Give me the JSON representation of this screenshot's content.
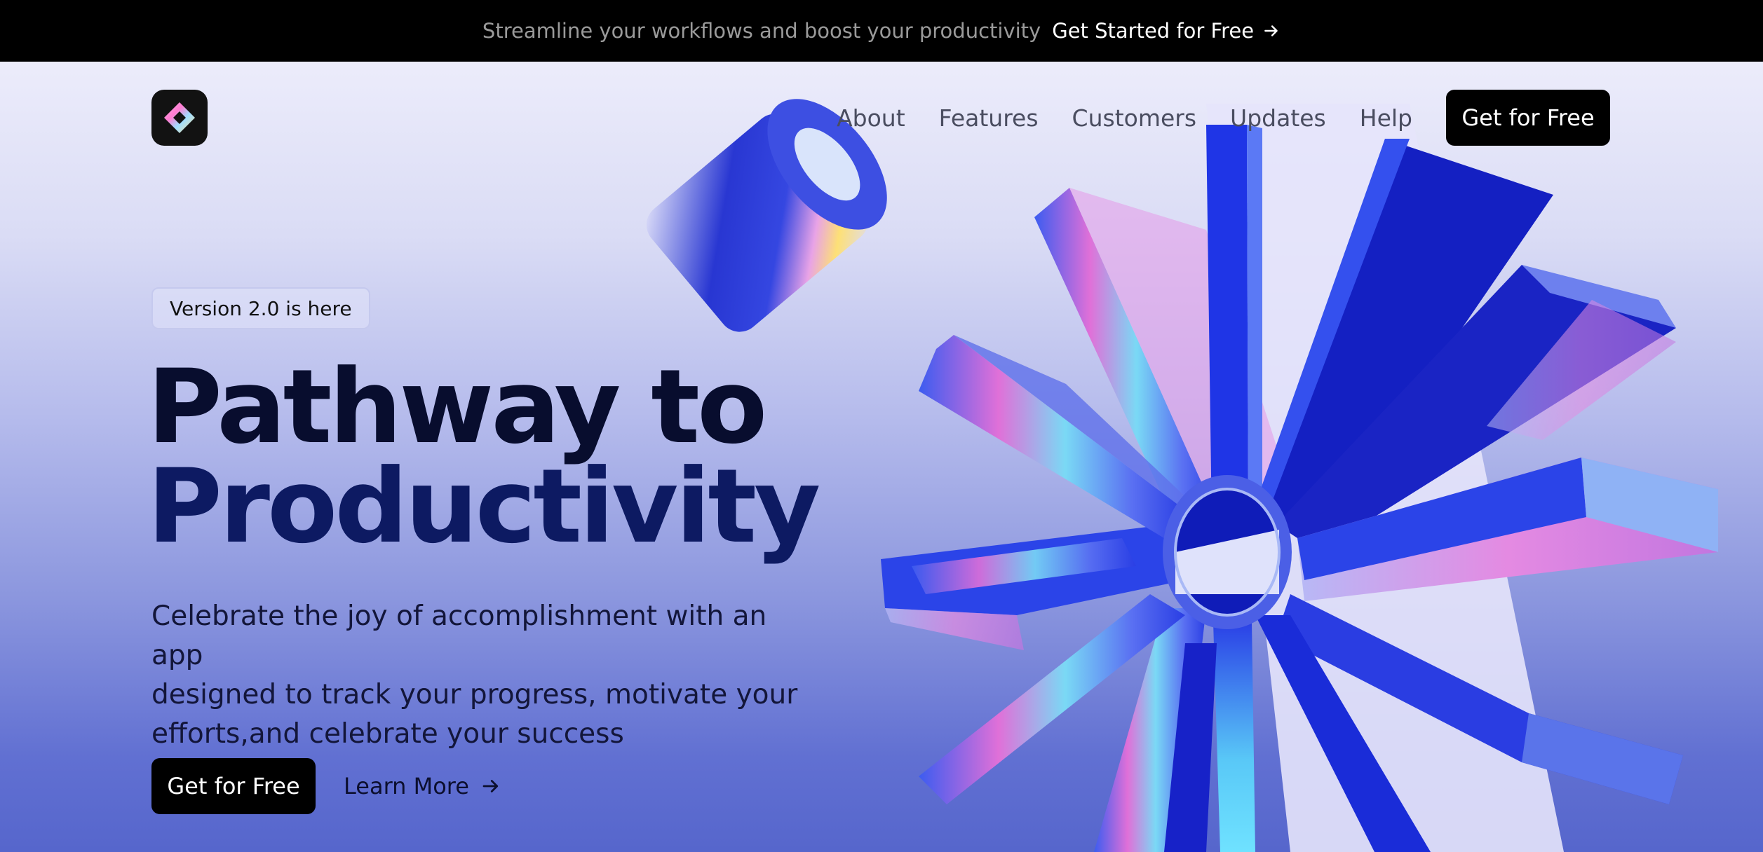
{
  "announcement": {
    "message": "Streamline your workflows and boost your productivity",
    "cta_label": "Get Started for Free",
    "cta_icon": "arrow-right-icon"
  },
  "nav": {
    "logo_icon": "diamond-logo-icon",
    "links": [
      "About",
      "Features",
      "Customers",
      "Updates",
      "Help"
    ],
    "cta_label": "Get for Free"
  },
  "hero": {
    "badge": "Version 2.0 is here",
    "headline_line1": "Pathway to",
    "headline_line2": "Productivity",
    "subtext_line1": "Celebrate the joy of accomplishment with an app",
    "subtext_line2": "designed to track your progress, motivate your",
    "subtext_line3": "efforts,and celebrate your success",
    "primary_cta": "Get for Free",
    "secondary_cta": "Learn More",
    "secondary_icon": "arrow-right-icon",
    "artwork_icons": [
      "starburst-3d-icon",
      "cylinder-3d-icon"
    ]
  },
  "colors": {
    "topbar_bg": "#000000",
    "accent_blue": "#2233d8",
    "headline_dark": "#080d2e",
    "headline_navy": "#0d1a62",
    "button_bg": "#000000"
  }
}
